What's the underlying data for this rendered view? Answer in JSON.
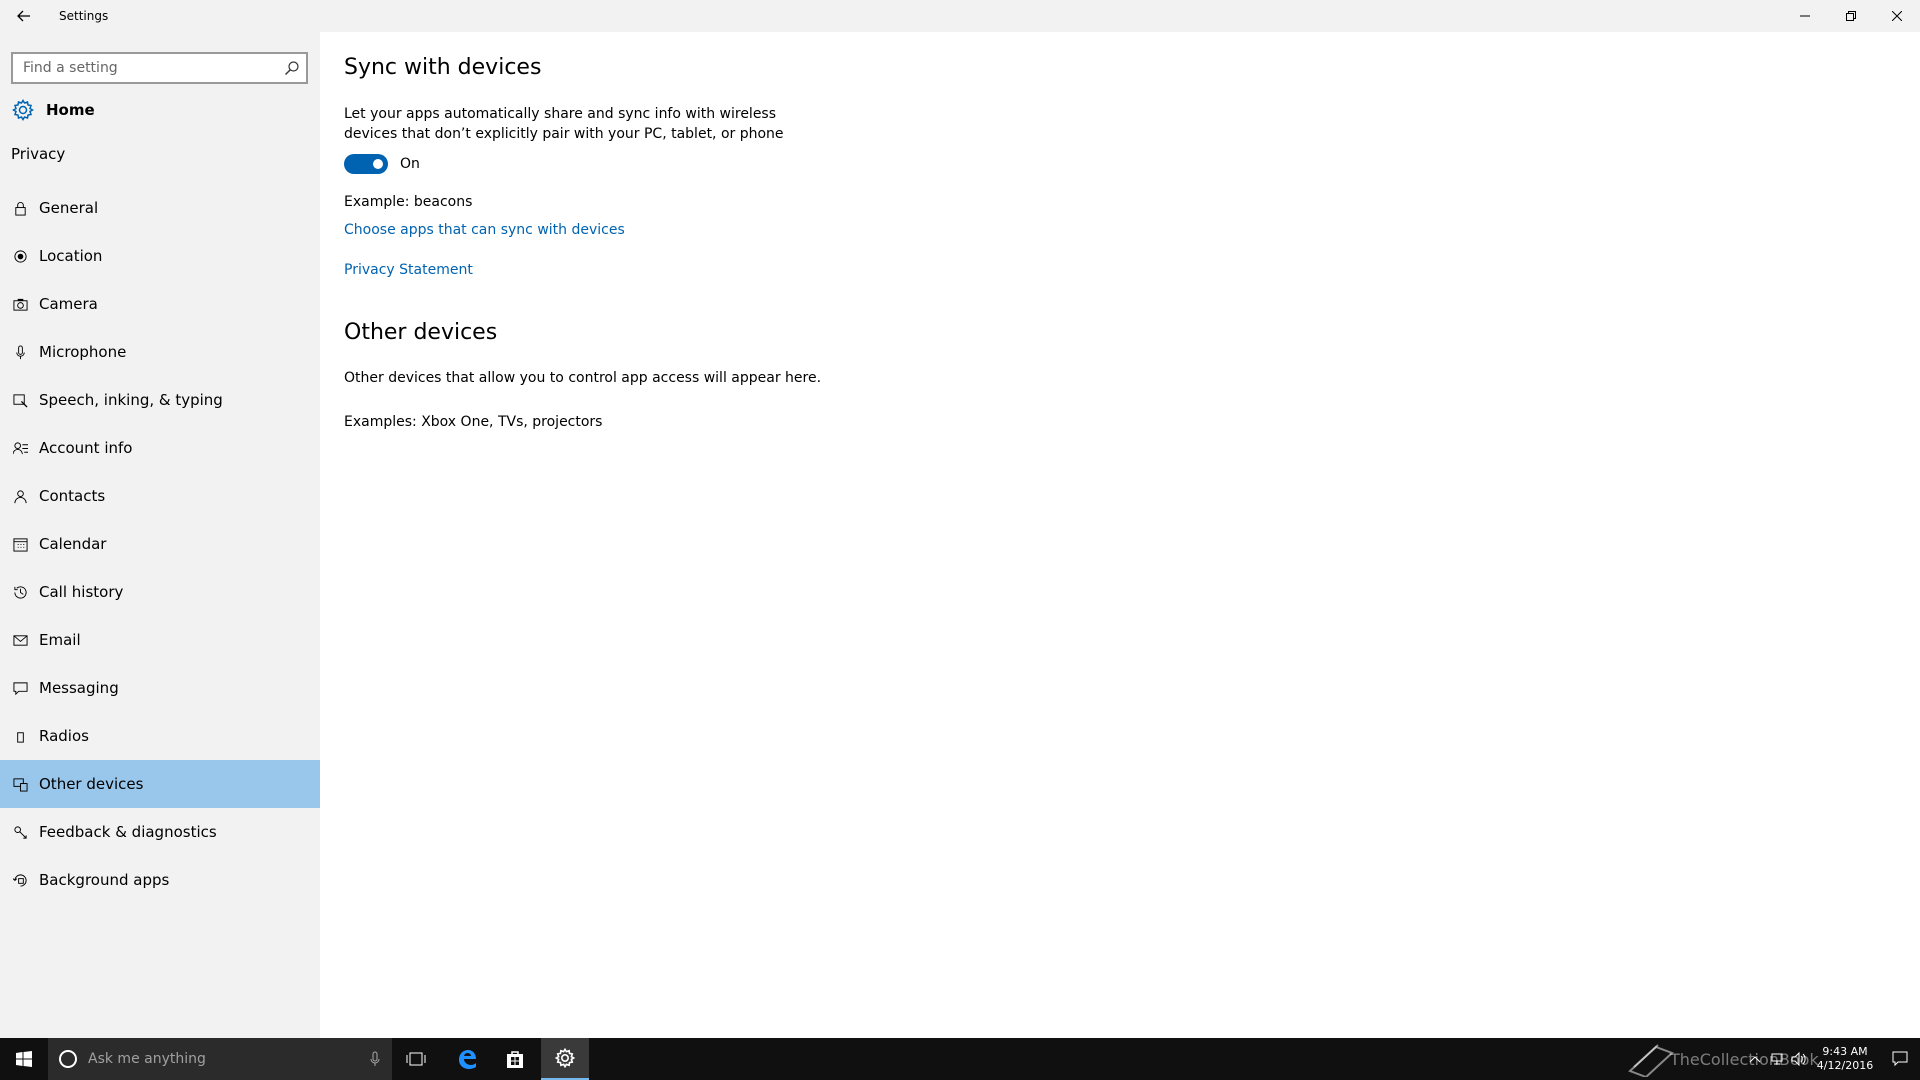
{
  "window": {
    "title": "Settings"
  },
  "sidebar": {
    "search_placeholder": "Find a setting",
    "home_label": "Home",
    "section_label": "Privacy",
    "items": [
      {
        "label": "General",
        "icon": "lock-icon"
      },
      {
        "label": "Location",
        "icon": "location-icon"
      },
      {
        "label": "Camera",
        "icon": "camera-icon"
      },
      {
        "label": "Microphone",
        "icon": "microphone-icon"
      },
      {
        "label": "Speech, inking, & typing",
        "icon": "speech-icon"
      },
      {
        "label": "Account info",
        "icon": "account-info-icon"
      },
      {
        "label": "Contacts",
        "icon": "contacts-icon"
      },
      {
        "label": "Calendar",
        "icon": "calendar-icon"
      },
      {
        "label": "Call history",
        "icon": "history-icon"
      },
      {
        "label": "Email",
        "icon": "email-icon"
      },
      {
        "label": "Messaging",
        "icon": "messaging-icon"
      },
      {
        "label": "Radios",
        "icon": "radios-icon"
      },
      {
        "label": "Other devices",
        "icon": "other-devices-icon",
        "selected": true
      },
      {
        "label": "Feedback & diagnostics",
        "icon": "feedback-icon"
      },
      {
        "label": "Background apps",
        "icon": "background-apps-icon"
      }
    ]
  },
  "main": {
    "sync_title": "Sync with devices",
    "sync_description": "Let your apps automatically share and sync info with wireless devices that don’t explicitly pair with your PC, tablet, or phone",
    "toggle_state": "On",
    "example_text": "Example: beacons",
    "choose_apps_link": "Choose apps that can sync with devices",
    "privacy_link": "Privacy Statement",
    "other_title": "Other devices",
    "other_description": "Other devices that allow you to control app access will appear here.",
    "other_examples": "Examples: Xbox One, TVs, projectors"
  },
  "taskbar": {
    "search_placeholder": "Ask me anything",
    "time": "9:43 AM",
    "date": "4/12/2016",
    "watermark": "TheCollectionBook"
  },
  "colors": {
    "accent": "#0063b1",
    "selected_bg": "#99c7ec",
    "sidebar_bg": "#f2f2f2",
    "taskbar_bg": "#101010"
  }
}
